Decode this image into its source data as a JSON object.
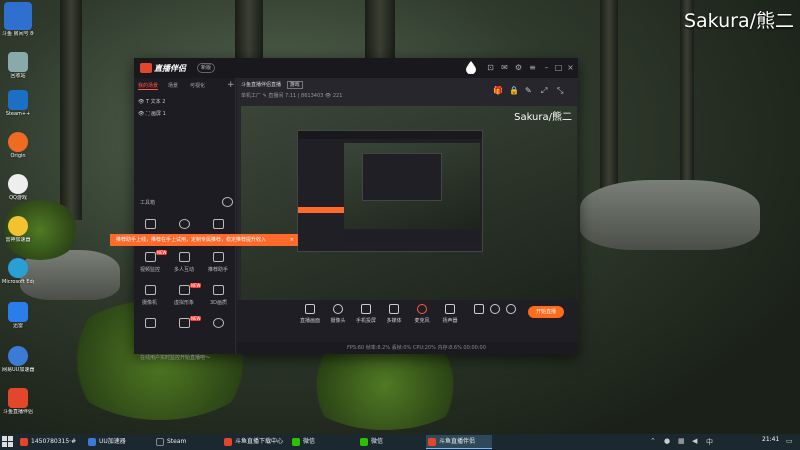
{
  "watermark": "Sakura/熊二",
  "desktop_icons": [
    {
      "label": "斗鱼 房间号 8613403",
      "icon": "douyu-room-icon",
      "color": "#2e6fd0"
    },
    {
      "label": "回收站",
      "icon": "recycle-bin-icon",
      "color": "#8aa"
    },
    {
      "label": "Steam++",
      "icon": "steam-plus-icon",
      "color": "#1b6fc4"
    },
    {
      "label": "Origin",
      "icon": "origin-icon",
      "color": "#f06b22"
    },
    {
      "label": "QQ游戏",
      "icon": "qq-game-icon",
      "color": "#eee"
    },
    {
      "label": "雷神加速器",
      "icon": "leishen-icon",
      "color": "#f2c230"
    },
    {
      "label": "Microsoft Edge",
      "icon": "edge-icon",
      "color": "#2a9fd6"
    },
    {
      "label": "迅雷",
      "icon": "xunlei-icon",
      "color": "#2b7de9"
    },
    {
      "label": "网易UU加速器",
      "icon": "uu-accelerator-icon",
      "color": "#3a7bd5"
    },
    {
      "label": "斗鱼直播伴侣",
      "icon": "douyu-companion-icon",
      "color": "#e4462c"
    }
  ],
  "app": {
    "name": "直播伴侣",
    "version": "新版",
    "tabs": [
      "我的场景",
      "场景",
      "可视化"
    ],
    "layers": [
      "文本 2",
      "画屏 1"
    ],
    "toolbox_label": "工具箱",
    "tools": [
      {
        "label": "",
        "badge": ""
      },
      {
        "label": "",
        "badge": ""
      },
      {
        "label": "",
        "badge": ""
      },
      {
        "label": "视频监控",
        "badge": "NEW"
      },
      {
        "label": "多人互动",
        "badge": ""
      },
      {
        "label": "推荐助手",
        "badge": ""
      },
      {
        "label": "摄像机",
        "badge": ""
      },
      {
        "label": "虚拟形象",
        "badge": "NEW"
      },
      {
        "label": "3D画质",
        "badge": ""
      },
      {
        "label": "",
        "badge": ""
      },
      {
        "label": "",
        "badge": "NEW"
      },
      {
        "label": "",
        "badge": ""
      }
    ],
    "tip_text": "推荐助手上线，推荐在手上试用，定制专属推荐，稳定推荐提升收入",
    "tip_close": "×",
    "bottom_note": "在线用户实时监控开始直播吧～",
    "main_title": "斗鱼直播伴侣直播",
    "main_badge": "游戏",
    "sub_info": "单机工厂 ✎   直播间 7:11 | 8613403   👁 221",
    "preview_watermark": "Sakura/熊二",
    "controls": [
      "直播画面",
      "摄像头",
      "手机投屏",
      "多媒体",
      "麦克风",
      "扬声器"
    ],
    "live_button": "开始直播",
    "status_text": "FPS:60   帧率:8.2%   丢帧:0%   CPU:20%   内存:8.6%   00:00:00"
  },
  "taskbar": {
    "items": [
      {
        "label": "1450780315·#",
        "icon_color": "#e4462c",
        "active": false
      },
      {
        "label": "UU加速器",
        "icon_color": "#3a7bd5",
        "active": false
      },
      {
        "label": "Steam",
        "icon_color": "#1b2838",
        "active": false
      },
      {
        "label": "斗鱼直播下载中心",
        "icon_color": "#e4462c",
        "active": false
      },
      {
        "label": "微信",
        "icon_color": "#2dc100",
        "active": false
      },
      {
        "label": "微信",
        "icon_color": "#2dc100",
        "active": false
      },
      {
        "label": "斗鱼直播伴侣",
        "icon_color": "#e4462c",
        "active": true
      }
    ],
    "time": "21:41"
  }
}
